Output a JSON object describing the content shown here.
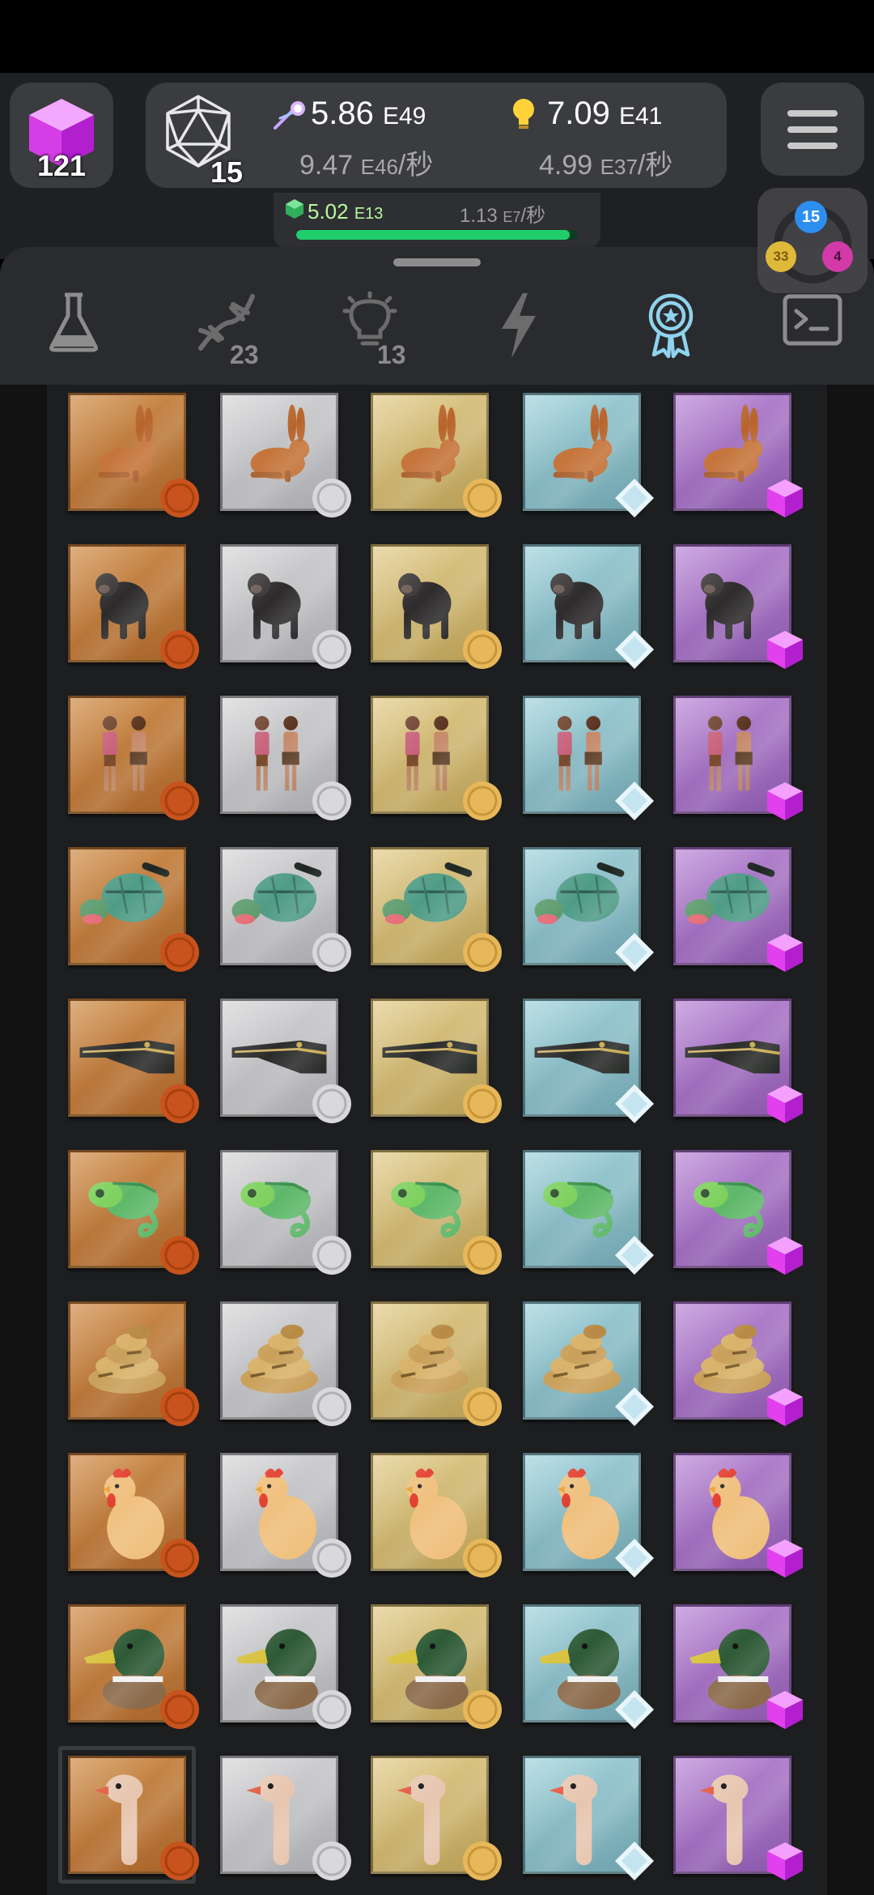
{
  "header": {
    "cube_count": "121",
    "dice_count": "15",
    "resource1": {
      "value": "5.86",
      "exp": "E49",
      "rate_value": "9.47",
      "rate_exp": "E46",
      "rate_unit": "/秒"
    },
    "resource2": {
      "value": "7.09",
      "exp": "E41",
      "rate_value": "4.99",
      "rate_exp": "E37",
      "rate_unit": "/秒"
    },
    "gem": {
      "value": "5.02",
      "exp": "E13",
      "rate_value": "1.13",
      "rate_exp": "E7",
      "rate_unit": "/秒",
      "progress": 0.97
    }
  },
  "stats_widget": {
    "top_badge": "15",
    "left_badge": "33",
    "right_badge": "4"
  },
  "tabs": [
    {
      "icon": "flask-icon",
      "badge": ""
    },
    {
      "icon": "dna-icon",
      "badge": "23"
    },
    {
      "icon": "lightbulb-icon",
      "badge": "13"
    },
    {
      "icon": "lightning-icon",
      "badge": ""
    },
    {
      "icon": "award-medal-icon",
      "badge": "",
      "active": true
    },
    {
      "icon": "terminal-icon",
      "badge": ""
    }
  ],
  "tiers": [
    "bronze",
    "silver",
    "gold",
    "diamond",
    "amethyst"
  ],
  "animals": [
    "rabbit",
    "chimpanzee",
    "humans",
    "turtle",
    "crocodile",
    "chameleon",
    "snake",
    "chicken",
    "duck",
    "ostrich"
  ],
  "colors": {
    "accent_active_tab": "#8fd3ee",
    "progress": "#1fce6a",
    "amethyst": "#e240ee"
  }
}
